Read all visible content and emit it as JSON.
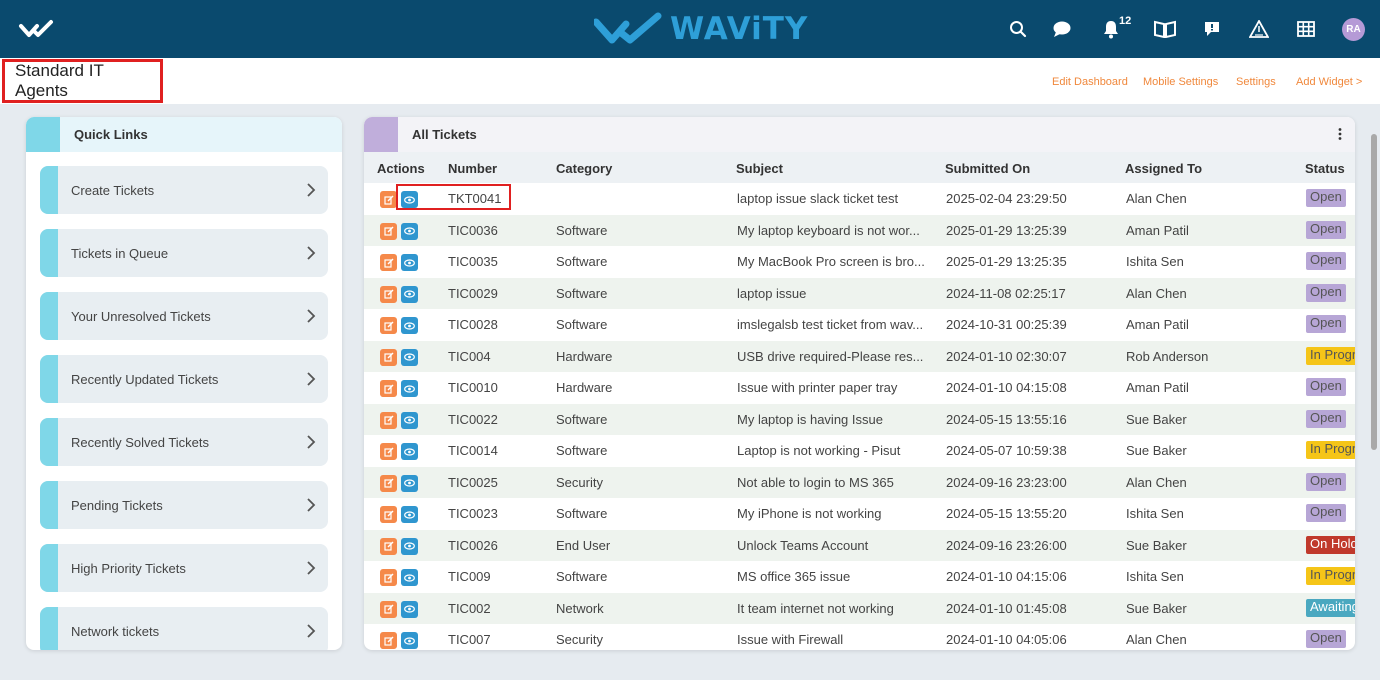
{
  "header": {
    "brand": "WAViTY",
    "notification_count": "12",
    "avatar_initials": "RA",
    "icons": [
      "menu-logo-icon",
      "search-icon",
      "chat-icon",
      "bell-icon",
      "book-icon",
      "message-icon",
      "alert-icon",
      "grid-icon"
    ]
  },
  "subheader": {
    "title": "Standard IT Agents",
    "links": [
      "Edit Dashboard",
      "Mobile Settings",
      "Settings",
      "Add Widget >"
    ]
  },
  "quick_links": {
    "title": "Quick Links",
    "items": [
      "Create Tickets",
      "Tickets in Queue",
      "Your Unresolved Tickets",
      "Recently Updated Tickets",
      "Recently Solved Tickets",
      "Pending Tickets",
      "High Priority Tickets",
      "Network tickets"
    ]
  },
  "tickets": {
    "title": "All Tickets",
    "columns": [
      "Actions",
      "Number",
      "Category",
      "Subject",
      "Submitted On",
      "Assigned To",
      "Status"
    ],
    "rows": [
      {
        "number": "TKT0041",
        "category": "",
        "subject": "laptop issue slack ticket test",
        "submitted": "2025-02-04 23:29:50",
        "assigned": "Alan Chen",
        "status": "Open"
      },
      {
        "number": "TIC0036",
        "category": "Software",
        "subject": "My laptop keyboard is not wor...",
        "submitted": "2025-01-29 13:25:39",
        "assigned": "Aman Patil",
        "status": "Open"
      },
      {
        "number": "TIC0035",
        "category": "Software",
        "subject": "My MacBook Pro screen is bro...",
        "submitted": "2025-01-29 13:25:35",
        "assigned": "Ishita Sen",
        "status": "Open"
      },
      {
        "number": "TIC0029",
        "category": "Software",
        "subject": "laptop issue",
        "submitted": "2024-11-08 02:25:17",
        "assigned": "Alan Chen",
        "status": "Open"
      },
      {
        "number": "TIC0028",
        "category": "Software",
        "subject": "imslegalsb test ticket from wav...",
        "submitted": "2024-10-31 00:25:39",
        "assigned": "Aman Patil",
        "status": "Open"
      },
      {
        "number": "TIC004",
        "category": "Hardware",
        "subject": "USB drive required-Please res...",
        "submitted": "2024-01-10 02:30:07",
        "assigned": "Rob Anderson",
        "status": "In Progr"
      },
      {
        "number": "TIC0010",
        "category": "Hardware",
        "subject": "Issue with printer paper tray",
        "submitted": "2024-01-10 04:15:08",
        "assigned": "Aman Patil",
        "status": "Open"
      },
      {
        "number": "TIC0022",
        "category": "Software",
        "subject": "My laptop is having Issue",
        "submitted": "2024-05-15 13:55:16",
        "assigned": "Sue Baker",
        "status": "Open"
      },
      {
        "number": "TIC0014",
        "category": "Software",
        "subject": "Laptop is not working - Pisut",
        "submitted": "2024-05-07 10:59:38",
        "assigned": "Sue Baker",
        "status": "In Progr"
      },
      {
        "number": "TIC0025",
        "category": "Security",
        "subject": "Not able to login to MS 365",
        "submitted": "2024-09-16 23:23:00",
        "assigned": "Alan Chen",
        "status": "Open"
      },
      {
        "number": "TIC0023",
        "category": "Software",
        "subject": "My iPhone is not working",
        "submitted": "2024-05-15 13:55:20",
        "assigned": "Ishita Sen",
        "status": "Open"
      },
      {
        "number": "TIC0026",
        "category": "End User",
        "subject": "Unlock Teams Account",
        "submitted": "2024-09-16 23:26:00",
        "assigned": "Sue Baker",
        "status": "On Hold"
      },
      {
        "number": "TIC009",
        "category": "Software",
        "subject": "MS office 365 issue",
        "submitted": "2024-01-10 04:15:06",
        "assigned": "Ishita Sen",
        "status": "In Progr"
      },
      {
        "number": "TIC002",
        "category": "Network",
        "subject": "It team internet not working",
        "submitted": "2024-01-10 01:45:08",
        "assigned": "Sue Baker",
        "status": "Awaiting"
      },
      {
        "number": "TIC007",
        "category": "Security",
        "subject": "Issue with Firewall",
        "submitted": "2024-01-10 04:05:06",
        "assigned": "Alan Chen",
        "status": "Open"
      }
    ]
  },
  "colors": {
    "topbar": "#0a4a6e",
    "brand": "#2e9fd8",
    "accent_orange": "#f0883c",
    "quicklink_strip": "#7fd7e8",
    "status_open": "#b7a6d6",
    "status_in_progress": "#f5c518",
    "status_on_hold": "#c0392b",
    "status_awaiting": "#4aa8c0"
  }
}
